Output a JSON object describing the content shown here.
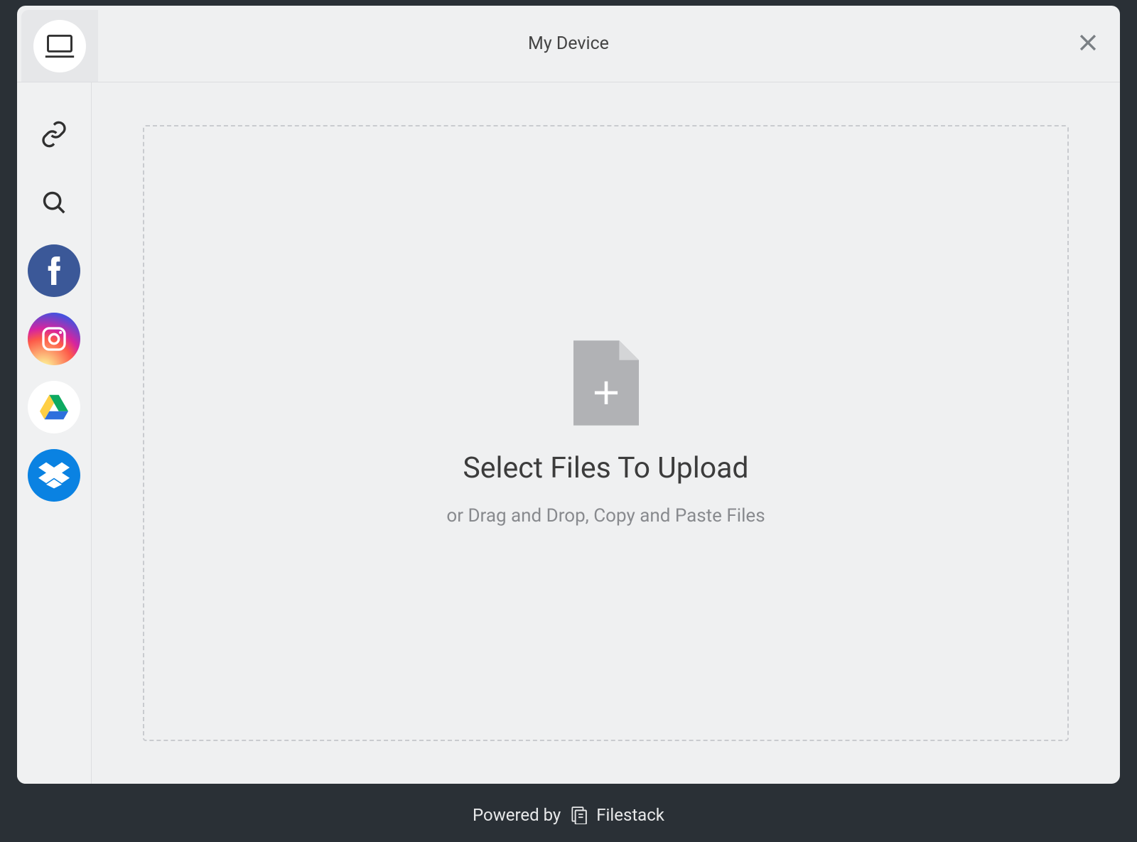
{
  "header": {
    "title": "My Device"
  },
  "sidebar": {
    "sources": [
      {
        "id": "device",
        "label": "My Device"
      },
      {
        "id": "link",
        "label": "Link (URL)"
      },
      {
        "id": "search",
        "label": "Web Search"
      },
      {
        "id": "facebook",
        "label": "Facebook"
      },
      {
        "id": "instagram",
        "label": "Instagram"
      },
      {
        "id": "googledrive",
        "label": "Google Drive"
      },
      {
        "id": "dropbox",
        "label": "Dropbox"
      }
    ]
  },
  "dropzone": {
    "title": "Select Files To Upload",
    "subtitle": "or Drag and Drop, Copy and Paste Files"
  },
  "footer": {
    "prefix": "Powered by",
    "brand": "Filestack"
  },
  "background": {
    "powered_hint": "Powered by"
  }
}
